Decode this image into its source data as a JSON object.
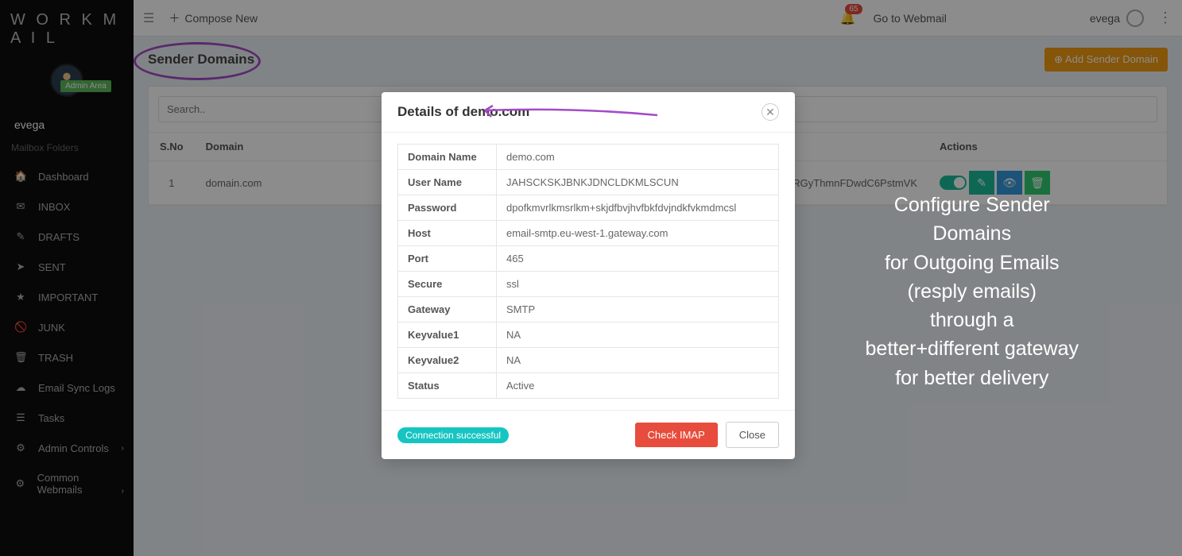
{
  "brand": "W O R K  M A I L",
  "admin_badge": "Admin Area",
  "username": "evega",
  "folders_header": "Mailbox Folders",
  "nav": {
    "dashboard": "Dashboard",
    "inbox": "INBOX",
    "drafts": "DRAFTS",
    "sent": "SENT",
    "important": "IMPORTANT",
    "junk": "JUNK",
    "trash": "TRASH",
    "sync": "Email Sync Logs",
    "tasks": "Tasks",
    "admin_controls": "Admin Controls",
    "common_webmails": "Common Webmails"
  },
  "topbar": {
    "compose": "Compose New",
    "notif_count": "65",
    "go_webmail": "Go to Webmail",
    "user": "evega"
  },
  "page": {
    "title": "Sender Domains",
    "add_btn": "⊕ Add Sender Domain",
    "search_placeholder": "Search.."
  },
  "table": {
    "headers": {
      "sno": "S.No",
      "domain": "Domain",
      "actions": "Actions"
    },
    "row": {
      "sno": "1",
      "domain": "domain.com",
      "extra": "RGyThmnFDwdC6PstmVK"
    }
  },
  "modal": {
    "title": "Details of demo.com",
    "rows": {
      "domain_name_label": "Domain Name",
      "domain_name": "demo.com",
      "user_name_label": "User Name",
      "user_name": "JAHSCKSKJBNKJDNCLDKMLSCUN",
      "password_label": "Password",
      "password": "dpofkmvrlkmsrlkm+skjdfbvjhvfbkfdvjndkfvkmdmcsl",
      "host_label": "Host",
      "host": "email-smtp.eu-west-1.gateway.com",
      "port_label": "Port",
      "port": "465",
      "secure_label": "Secure",
      "secure": "ssl",
      "gateway_label": "Gateway",
      "gateway": "SMTP",
      "kv1_label": "Keyvalue1",
      "kv1": "NA",
      "kv2_label": "Keyvalue2",
      "kv2": "NA",
      "status_label": "Status",
      "status": "Active"
    },
    "conn_status": "Connection successful",
    "check_btn": "Check IMAP",
    "close_btn": "Close"
  },
  "annotation": "Configure Sender Domains\nfor Outgoing Emails\n(resply emails)\nthrough a better+different gateway\nfor better delivery"
}
